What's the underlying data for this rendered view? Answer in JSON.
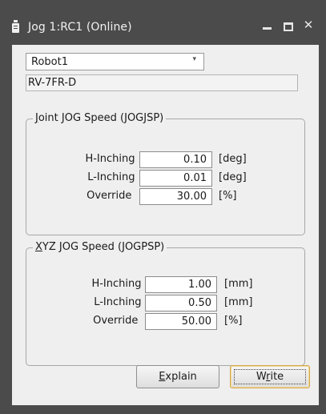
{
  "window": {
    "title": "Jog 1:RC1 (Online)",
    "minimize_icon": "minimize-icon",
    "maximize_icon": "maximize-icon",
    "close_glyph": "✕"
  },
  "robot_select": {
    "value": "Robot1",
    "arrow": "▾"
  },
  "model": {
    "value": "RV-7FR-D"
  },
  "joint_group": {
    "legend_mnemonic": "J",
    "legend_rest": "oint JOG Speed (JOGJSP)",
    "rows": [
      {
        "label": "H-Inching :",
        "value": "0.10",
        "unit": "[deg]"
      },
      {
        "label": "L-Inching :",
        "value": "0.01",
        "unit": "[deg]"
      },
      {
        "label": "Override  :",
        "value": "30.00",
        "unit": "[%]"
      }
    ]
  },
  "xyz_group": {
    "legend_mnemonic": "X",
    "legend_rest": "YZ JOG Speed (JOGPSP)",
    "rows": [
      {
        "label": "H-Inching :",
        "value": "1.00",
        "unit": "[mm]"
      },
      {
        "label": "L-Inching :",
        "value": "0.50",
        "unit": "[mm]"
      },
      {
        "label": "Override  :",
        "value": "50.00",
        "unit": "[%]"
      }
    ]
  },
  "buttons": {
    "explain_mnemonic": "E",
    "explain_rest": "xplain",
    "write_pre": "W",
    "write_mnemonic": "r",
    "write_rest": "ite"
  }
}
